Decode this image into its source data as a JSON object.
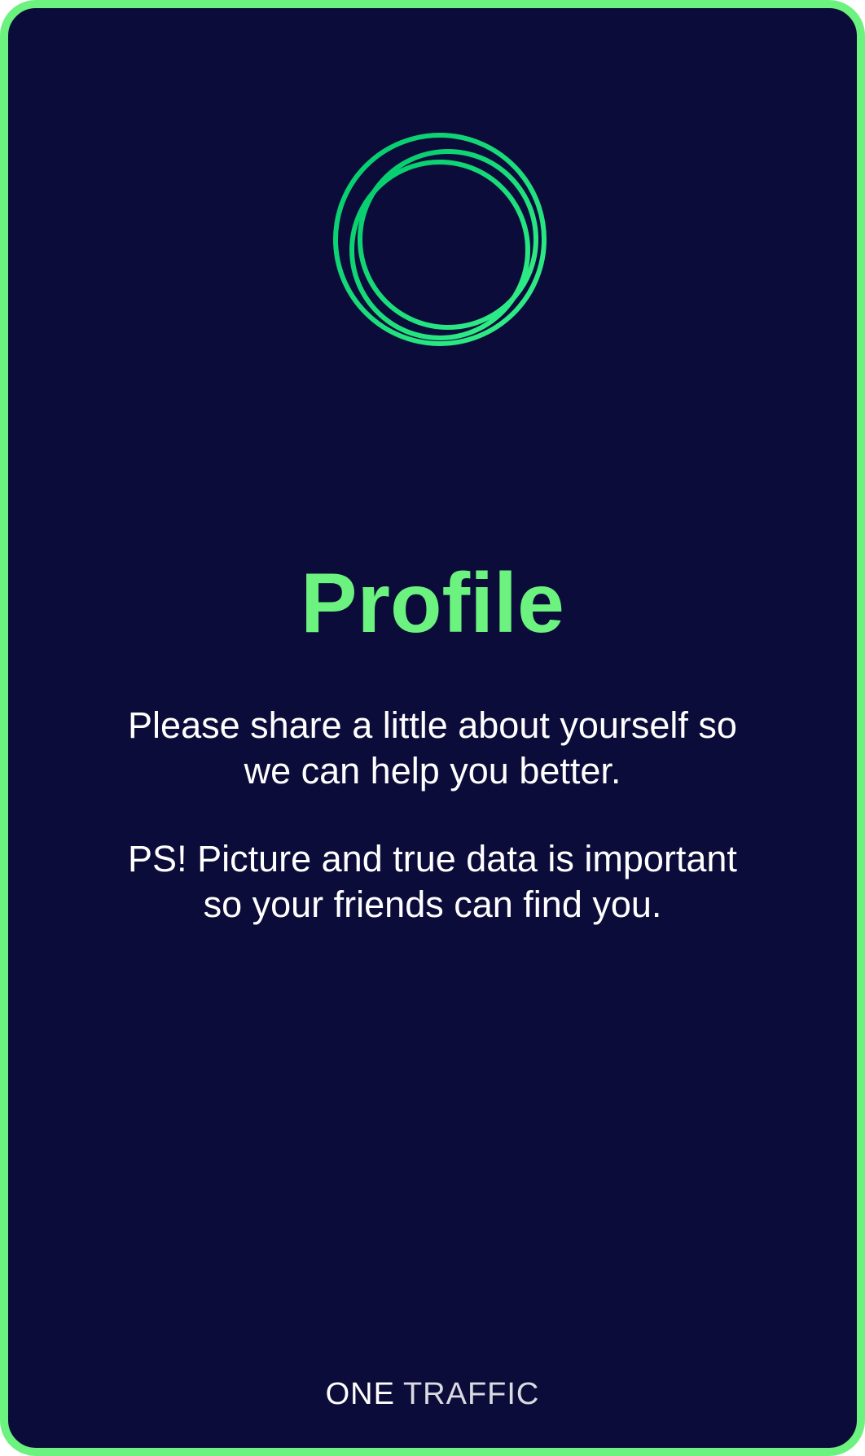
{
  "screen": {
    "title": "Profile",
    "message_line_1": "Please share a little about yourself so we can help you better.",
    "message_line_2": "PS! Picture and true data is important so your friends can find you."
  },
  "brand": {
    "part1": "ONE",
    "part2": "TRAFFIC"
  },
  "icons": {
    "logo": "green-concentric-rings-icon"
  },
  "colors": {
    "background": "#0c0c3a",
    "accent": "#6cf27f",
    "text": "#ffffff"
  }
}
